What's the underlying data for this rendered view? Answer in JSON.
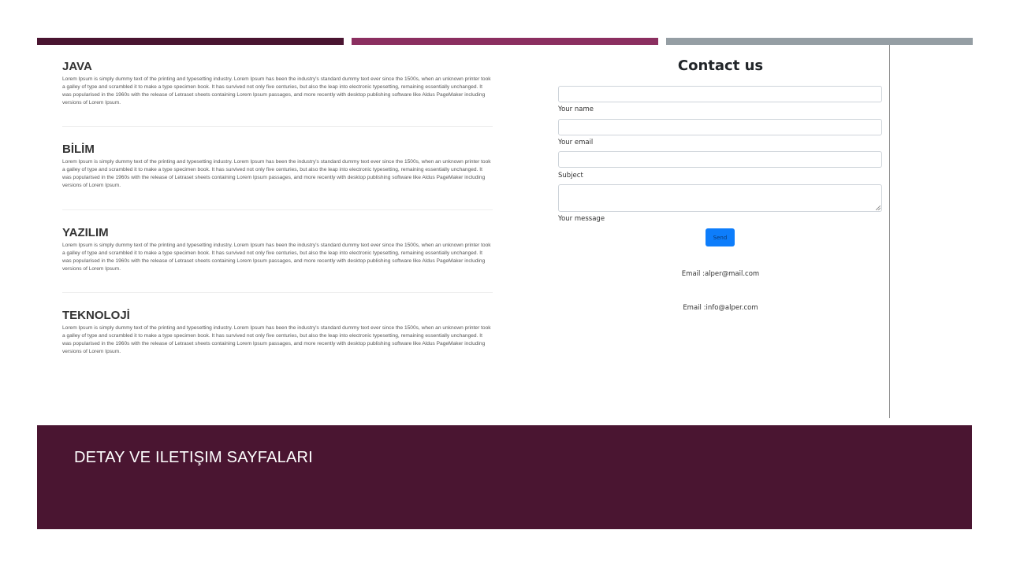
{
  "articles": [
    {
      "title": "JAVA",
      "body": "Lorem Ipsum is simply dummy text of the printing and typesetting industry. Lorem Ipsum has been the industry's standard dummy text ever since the 1500s, when an unknown printer took a galley of type and scrambled it to make a type specimen book. It has survived not only five centuries, but also the leap into electronic typesetting, remaining essentially unchanged. It was popularised in the 1960s with the release of Letraset sheets containing Lorem Ipsum passages, and more recently with desktop publishing software like Aldus PageMaker including versions of Lorem Ipsum."
    },
    {
      "title": "BİLİM",
      "body": "Lorem Ipsum is simply dummy text of the printing and typesetting industry. Lorem Ipsum has been the industry's standard dummy text ever since the 1500s, when an unknown printer took a galley of type and scrambled it to make a type specimen book. It has survived not only five centuries, but also the leap into electronic typesetting, remaining essentially unchanged. It was popularised in the 1960s with the release of Letraset sheets containing Lorem Ipsum passages, and more recently with desktop publishing software like Aldus PageMaker including versions of Lorem Ipsum."
    },
    {
      "title": "YAZILIM",
      "body": "Lorem Ipsum is simply dummy text of the printing and typesetting industry. Lorem Ipsum has been the industry's standard dummy text ever since the 1500s, when an unknown printer took a galley of type and scrambled it to make a type specimen book. It has survived not only five centuries, but also the leap into electronic typesetting, remaining essentially unchanged. It was popularised in the 1960s with the release of Letraset sheets containing Lorem Ipsum passages, and more recently with desktop publishing software like Aldus PageMaker including versions of Lorem Ipsum."
    },
    {
      "title": "TEKNOLOJİ",
      "body": "Lorem Ipsum is simply dummy text of the printing and typesetting industry. Lorem Ipsum has been the industry's standard dummy text ever since the 1500s, when an unknown printer took a galley of type and scrambled it to make a type specimen book. It has survived not only five centuries, but also the leap into electronic typesetting, remaining essentially unchanged. It was popularised in the 1960s with the release of Letraset sheets containing Lorem Ipsum passages, and more recently with desktop publishing software like Aldus PageMaker including versions of Lorem Ipsum."
    }
  ],
  "contact": {
    "title": "Contact us",
    "name_label": "Your name",
    "email_label": "Your email",
    "subject_label": "Subject",
    "message_label": "Your message",
    "send_label": "Send",
    "email1": "Email :alper@mail.com",
    "email2": "Email :info@alper.com"
  },
  "footer": {
    "title": "DETAY VE ILETIŞIM SAYFALARI"
  },
  "colors": {
    "bar_dark": "#4a1531",
    "bar_mid": "#8b2f60",
    "bar_gray": "#959ea4",
    "send_button": "#0d7dfb"
  }
}
